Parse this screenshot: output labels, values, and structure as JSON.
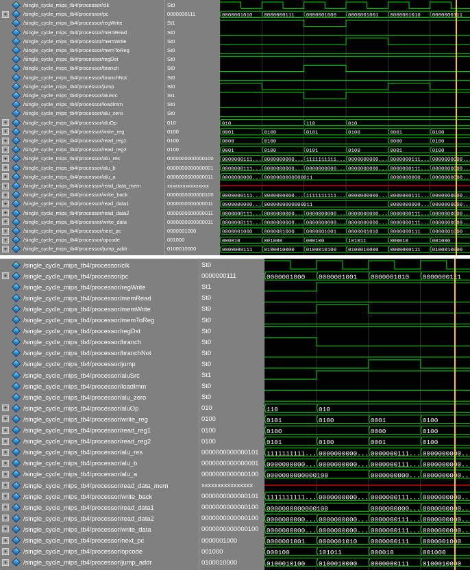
{
  "colors": {
    "signal": "#00e000",
    "cursor": "#ffcc00",
    "undefined": "#e00000",
    "grid": "#404040"
  },
  "icons": {
    "expand": "plus-icon",
    "signal": "signal-diamond-icon"
  },
  "signals": [
    {
      "name": "/single_cycle_mips_tb4/processor/clk",
      "expandable": false
    },
    {
      "name": "/single_cycle_mips_tb4/processor/pc",
      "expandable": true
    },
    {
      "name": "/single_cycle_mips_tb4/processor/regWrite",
      "expandable": false
    },
    {
      "name": "/single_cycle_mips_tb4/processor/memRead",
      "expandable": false
    },
    {
      "name": "/single_cycle_mips_tb4/processor/memWrite",
      "expandable": false
    },
    {
      "name": "/single_cycle_mips_tb4/processor/memToReg",
      "expandable": false
    },
    {
      "name": "/single_cycle_mips_tb4/processor/regDst",
      "expandable": false
    },
    {
      "name": "/single_cycle_mips_tb4/processor/branch",
      "expandable": false
    },
    {
      "name": "/single_cycle_mips_tb4/processor/branchNot",
      "expandable": false
    },
    {
      "name": "/single_cycle_mips_tb4/processor/jump",
      "expandable": false
    },
    {
      "name": "/single_cycle_mips_tb4/processor/aluSrc",
      "expandable": false
    },
    {
      "name": "/single_cycle_mips_tb4/processor/loadImm",
      "expandable": false
    },
    {
      "name": "/single_cycle_mips_tb4/processor/alu_zero",
      "expandable": false
    },
    {
      "name": "/single_cycle_mips_tb4/processor/aluOp",
      "expandable": true
    },
    {
      "name": "/single_cycle_mips_tb4/processor/write_reg",
      "expandable": true
    },
    {
      "name": "/single_cycle_mips_tb4/processor/read_reg1",
      "expandable": true
    },
    {
      "name": "/single_cycle_mips_tb4/processor/read_reg2",
      "expandable": true
    },
    {
      "name": "/single_cycle_mips_tb4/processor/alu_res",
      "expandable": true
    },
    {
      "name": "/single_cycle_mips_tb4/processor/alu_b",
      "expandable": true
    },
    {
      "name": "/single_cycle_mips_tb4/processor/alu_a",
      "expandable": true
    },
    {
      "name": "/single_cycle_mips_tb4/processor/read_data_mem",
      "expandable": true
    },
    {
      "name": "/single_cycle_mips_tb4/processor/write_back",
      "expandable": true
    },
    {
      "name": "/single_cycle_mips_tb4/processor/read_data1",
      "expandable": true
    },
    {
      "name": "/single_cycle_mips_tb4/processor/read_data2",
      "expandable": true
    },
    {
      "name": "/single_cycle_mips_tb4/processor/write_data",
      "expandable": true
    },
    {
      "name": "/single_cycle_mips_tb4/processor/next_pc",
      "expandable": true
    },
    {
      "name": "/single_cycle_mips_tb4/processor/opcode",
      "expandable": true
    },
    {
      "name": "/single_cycle_mips_tb4/processor/jump_addr",
      "expandable": true
    }
  ],
  "panes": [
    {
      "values": [
        "St0",
        "0000000111",
        "St1",
        "St0",
        "St0",
        "St0",
        "St0",
        "St0",
        "St0",
        "St0",
        "St1",
        "St0",
        "St0",
        "010",
        "0100",
        "0100",
        "0100",
        "0000000000000100",
        "0000000000000001",
        "0000000000000011",
        "xxxxxxxxxxxxxxxx",
        "0000000000000100",
        "0000000000000011",
        "0000000000000011",
        "0000000000000011",
        "0000001000",
        "001000",
        "0100010000"
      ],
      "waves": [
        {
          "kind": "clock"
        },
        {
          "kind": "bus",
          "labels": [
            "0000001010",
            "0000000111",
            "0000001000",
            "0000001001",
            "0000001010",
            "0000000111"
          ]
        },
        {
          "kind": "bit",
          "levels": [
            1,
            1,
            0,
            1,
            1,
            1
          ]
        },
        {
          "kind": "bit",
          "levels": [
            0,
            0,
            0,
            0,
            0,
            0
          ]
        },
        {
          "kind": "bit",
          "levels": [
            0,
            0,
            0,
            1,
            0,
            0
          ]
        },
        {
          "kind": "bit",
          "levels": [
            0,
            0,
            0,
            0,
            0,
            0
          ]
        },
        {
          "kind": "bit",
          "levels": [
            1,
            1,
            1,
            1,
            1,
            1
          ]
        },
        {
          "kind": "bit",
          "levels": [
            0,
            0,
            1,
            0,
            0,
            0
          ]
        },
        {
          "kind": "bit",
          "levels": [
            0,
            0,
            0,
            0,
            0,
            0
          ]
        },
        {
          "kind": "bit",
          "levels": [
            1,
            0,
            0,
            0,
            1,
            0
          ]
        },
        {
          "kind": "bit",
          "levels": [
            1,
            1,
            0,
            1,
            1,
            1
          ]
        },
        {
          "kind": "bit",
          "levels": [
            0,
            0,
            0,
            0,
            0,
            0
          ]
        },
        {
          "kind": "bit",
          "levels": [
            0,
            0,
            0,
            0,
            0,
            0
          ]
        },
        {
          "kind": "bus",
          "labels": [
            "010",
            "",
            "110",
            "010",
            "",
            ""
          ]
        },
        {
          "kind": "bus",
          "labels": [
            "0001",
            "0100",
            "0101",
            "0100",
            "0001",
            "0100"
          ]
        },
        {
          "kind": "bus",
          "labels": [
            "0000",
            "0100",
            "",
            "",
            "0000",
            "0100"
          ]
        },
        {
          "kind": "bus",
          "labels": [
            "0001",
            "0100",
            "0101",
            "0100",
            "0001",
            "0100"
          ]
        },
        {
          "kind": "bus",
          "labels": [
            "0000000111...",
            "0000000000...",
            "1111111111...",
            "0000000000...",
            "0000000111...",
            "0000000000..."
          ]
        },
        {
          "kind": "bus",
          "labels": [
            "0000000111...",
            "0000000000...",
            "0000000000...",
            "0000000000...",
            "0000000111...",
            "0000000000..."
          ]
        },
        {
          "kind": "bus",
          "labels": [
            "0000000000...",
            "0000000000000011",
            "",
            "",
            "0000000000...",
            "0000000000..."
          ]
        },
        {
          "kind": "undef"
        },
        {
          "kind": "bus",
          "labels": [
            "0000000111...",
            "0000000000...",
            "1111111111...",
            "0000000000...",
            "0000000111...",
            "0000000000..."
          ]
        },
        {
          "kind": "bus",
          "labels": [
            "0000000000...",
            "0000000000000011",
            "",
            "",
            "0000000000...",
            "0000000000..."
          ]
        },
        {
          "kind": "bus",
          "labels": [
            "0000000111...",
            "0000000000...",
            "0000000000...",
            "0000000000...",
            "0000000111...",
            "0000000000..."
          ]
        },
        {
          "kind": "bus",
          "labels": [
            "0000000111...",
            "0000000000...",
            "0000000000...",
            "0000000000...",
            "0000000111...",
            "0000000000..."
          ]
        },
        {
          "kind": "bus",
          "labels": [
            "0000001000",
            "0000001000",
            "0000001001",
            "0000001010",
            "0000000111",
            "0000001000"
          ]
        },
        {
          "kind": "bus",
          "labels": [
            "000010",
            "001000",
            "000100",
            "101011",
            "000010",
            "001000"
          ]
        },
        {
          "kind": "bus",
          "labels": [
            "0000000111",
            "0100010000",
            "0100010100",
            "0100010000",
            "0000000111",
            "0100010000"
          ]
        }
      ]
    },
    {
      "values": [
        "St0",
        "0000000111",
        "St1",
        "St0",
        "St0",
        "St0",
        "St0",
        "St0",
        "St0",
        "St0",
        "St1",
        "St0",
        "St0",
        "010",
        "0100",
        "0100",
        "0100",
        "0000000000000101",
        "0000000000000001",
        "0000000000000100",
        "xxxxxxxxxxxxxxxx",
        "0000000000000101",
        "0000000000000100",
        "0000000000000100",
        "0000000000000100",
        "0000001000",
        "001000",
        "0100010000"
      ],
      "waves": [
        {
          "kind": "clock"
        },
        {
          "kind": "bus",
          "labels": [
            "0000001000",
            "0000001001",
            "0000001010",
            "0000000111"
          ]
        },
        {
          "kind": "bit",
          "levels": [
            0,
            1,
            1,
            1
          ]
        },
        {
          "kind": "bit",
          "levels": [
            0,
            0,
            0,
            0
          ]
        },
        {
          "kind": "bit",
          "levels": [
            0,
            1,
            0,
            0
          ]
        },
        {
          "kind": "bit",
          "levels": [
            0,
            0,
            0,
            0
          ]
        },
        {
          "kind": "bit",
          "levels": [
            1,
            1,
            1,
            1
          ]
        },
        {
          "kind": "bit",
          "levels": [
            1,
            0,
            0,
            0
          ]
        },
        {
          "kind": "bit",
          "levels": [
            0,
            0,
            0,
            0
          ]
        },
        {
          "kind": "bit",
          "levels": [
            0,
            0,
            1,
            0
          ]
        },
        {
          "kind": "bit",
          "levels": [
            0,
            1,
            1,
            1
          ]
        },
        {
          "kind": "bit",
          "levels": [
            0,
            0,
            0,
            0
          ]
        },
        {
          "kind": "bit",
          "levels": [
            0,
            0,
            0,
            0
          ]
        },
        {
          "kind": "bus",
          "labels": [
            "110",
            "010",
            "",
            ""
          ]
        },
        {
          "kind": "bus",
          "labels": [
            "0101",
            "0100",
            "0001",
            "0100"
          ]
        },
        {
          "kind": "bus",
          "labels": [
            "0100",
            "",
            "0000",
            "0100"
          ]
        },
        {
          "kind": "bus",
          "labels": [
            "0101",
            "0100",
            "0001",
            "0100"
          ]
        },
        {
          "kind": "bus",
          "labels": [
            "1111111111...",
            "0000000000...",
            "0000000111...",
            "0000000000..."
          ]
        },
        {
          "kind": "bus",
          "labels": [
            "0000000000...",
            "0000000000...",
            "0000000111...",
            "0000000000..."
          ]
        },
        {
          "kind": "bus",
          "labels": [
            "0000000000000100",
            "",
            "0000000000...",
            "0000000000..."
          ]
        },
        {
          "kind": "undef"
        },
        {
          "kind": "bus",
          "labels": [
            "1111111111...",
            "0000000000...",
            "0000000111...",
            "0000000000..."
          ]
        },
        {
          "kind": "bus",
          "labels": [
            "0000000000000100",
            "",
            "0000000000...",
            "0000000000..."
          ]
        },
        {
          "kind": "bus",
          "labels": [
            "0000000000...",
            "0000000000...",
            "0000000111...",
            "0000000000..."
          ]
        },
        {
          "kind": "bus",
          "labels": [
            "0000000000...",
            "0000000000...",
            "0000000111...",
            "0000000000..."
          ]
        },
        {
          "kind": "bus",
          "labels": [
            "0000001001",
            "0000001010",
            "0000000111",
            "0000001000"
          ]
        },
        {
          "kind": "bus",
          "labels": [
            "000100",
            "101011",
            "000010",
            "001000"
          ]
        },
        {
          "kind": "bus",
          "labels": [
            "0100010100",
            "0100010000",
            "0000000111",
            "0100010000"
          ]
        }
      ]
    }
  ]
}
